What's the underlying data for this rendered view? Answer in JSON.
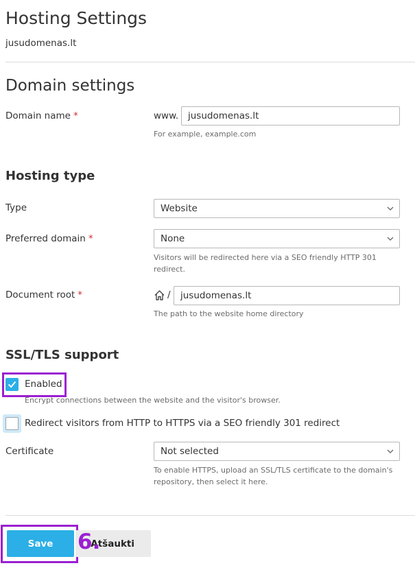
{
  "header": {
    "title": "Hosting Settings",
    "subtitle": "jusudomenas.lt"
  },
  "domain_settings": {
    "title": "Domain settings",
    "domain_name_label": "Domain name",
    "required_mark": "*",
    "www_prefix": "www.",
    "domain_value": "jusudomenas.lt",
    "domain_hint": "For example, example.com"
  },
  "hosting_type": {
    "title": "Hosting type",
    "type_label": "Type",
    "type_value": "Website",
    "preferred_label": "Preferred domain",
    "preferred_value": "None",
    "preferred_hint": "Visitors will be redirected here via a SEO friendly HTTP 301 redirect.",
    "docroot_label": "Document root",
    "docroot_separator": "/",
    "docroot_value": "jusudomenas.lt",
    "docroot_hint": "The path to the website home directory"
  },
  "ssl": {
    "title": "SSL/TLS support",
    "enabled_label": "Enabled",
    "enabled_checked": true,
    "enabled_hint": "Encrypt connections between the website and the visitor's browser.",
    "redirect_label": "Redirect visitors from HTTP to HTTPS via a SEO friendly 301 redirect",
    "redirect_checked": false,
    "certificate_label": "Certificate",
    "certificate_value": "Not selected",
    "certificate_hint": "To enable HTTPS, upload an SSL/TLS certificate to the domain's repository, then select it here."
  },
  "footer": {
    "save_label": "Save",
    "cancel_label": "Atšaukti",
    "step_marker": "6."
  },
  "colors": {
    "accent": "#2bafe6",
    "highlight": "#9b1fd1",
    "required": "#d02e2e"
  }
}
